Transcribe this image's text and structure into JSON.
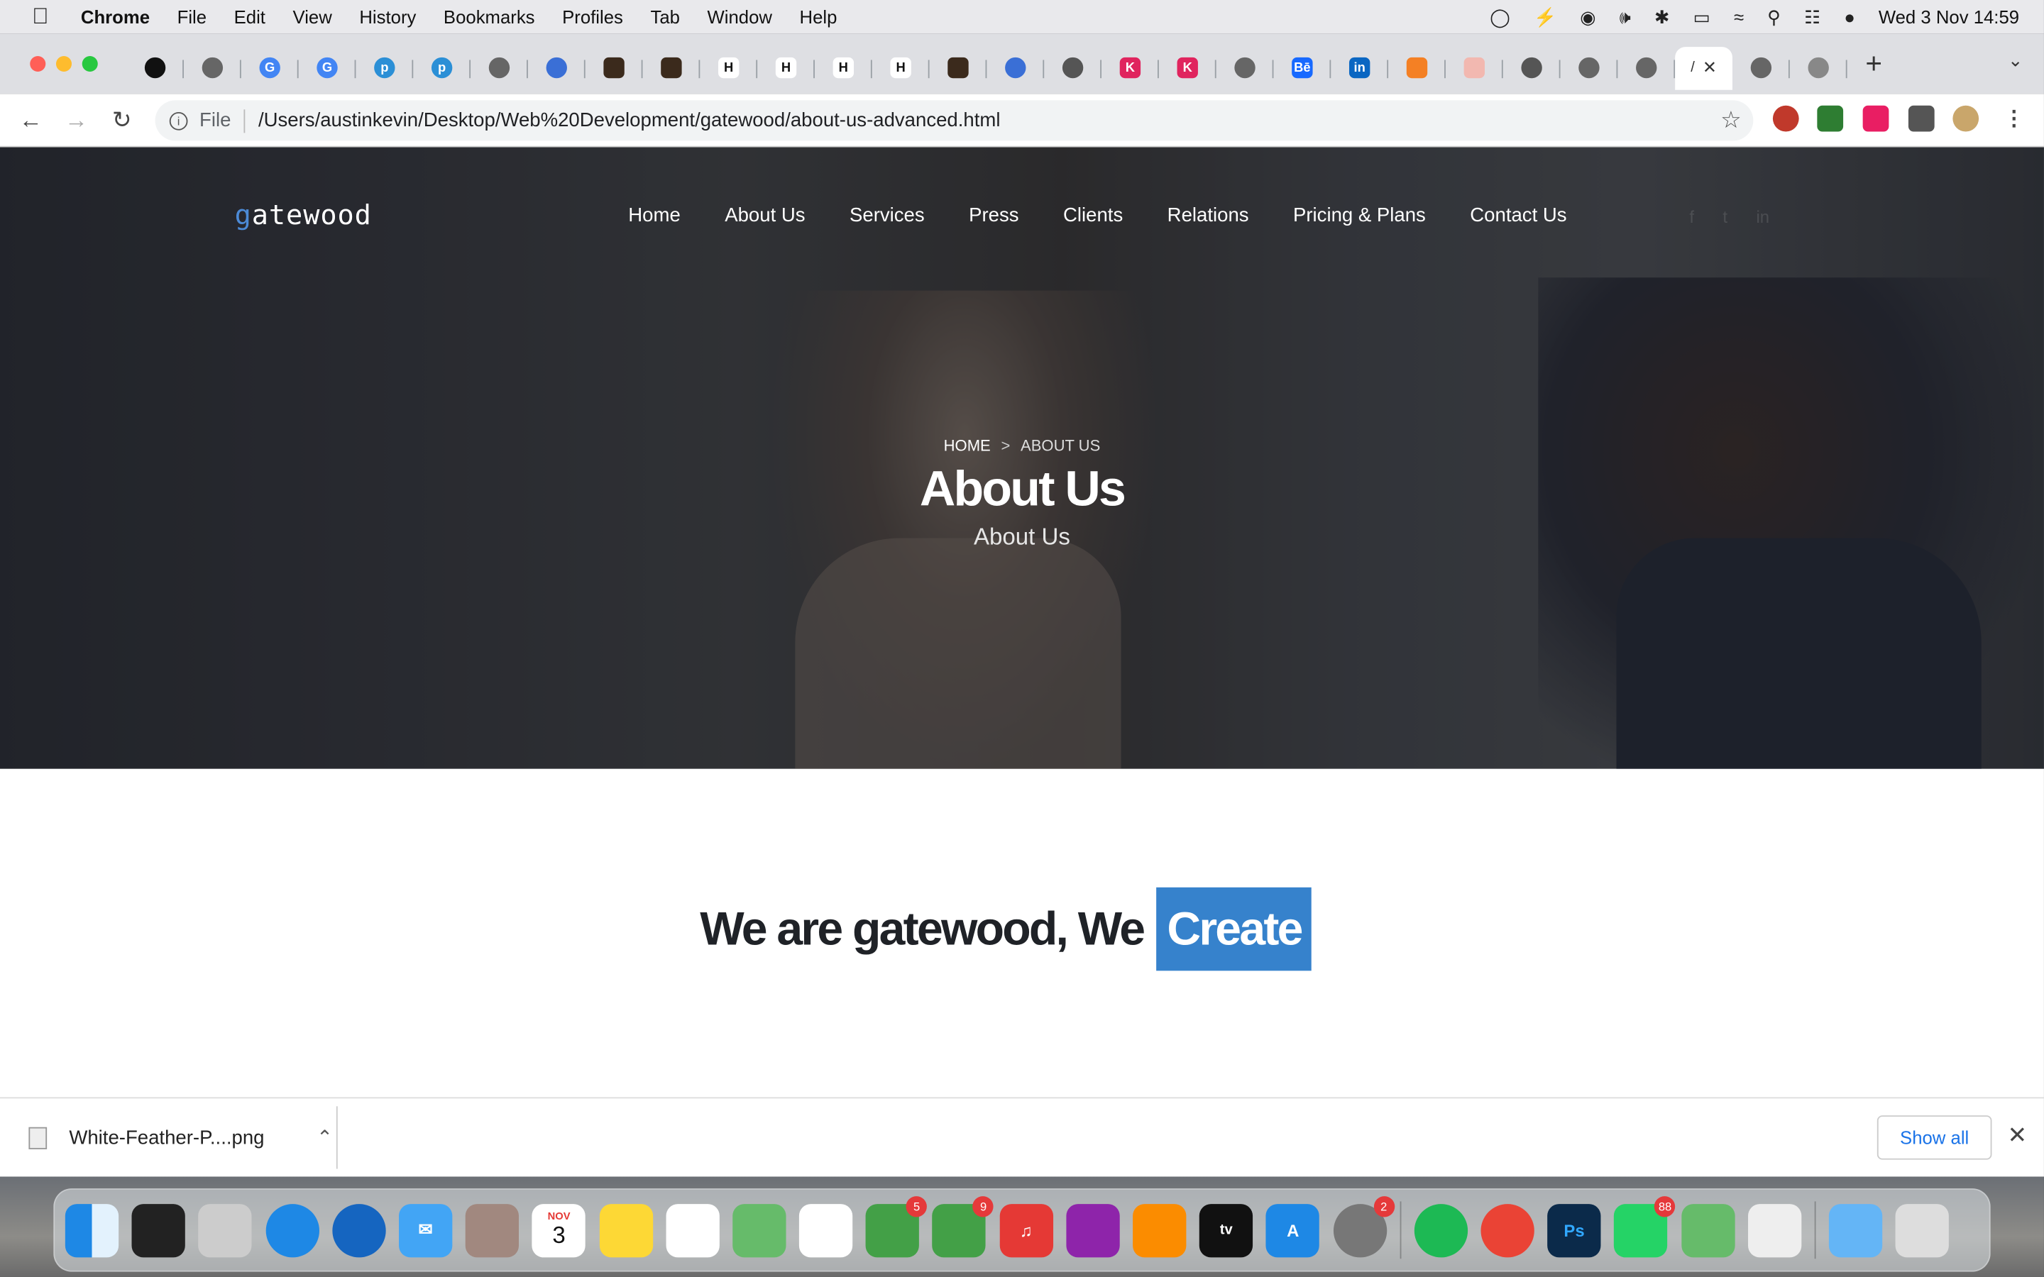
{
  "menubar": {
    "app": "Chrome",
    "items": [
      "File",
      "Edit",
      "View",
      "History",
      "Bookmarks",
      "Profiles",
      "Tab",
      "Window",
      "Help"
    ],
    "clock": "Wed 3 Nov  14:59"
  },
  "browser": {
    "url_scheme": "File",
    "url": "/Users/austinkevin/Desktop/Web%20Development/gatewood/about-us-advanced.html"
  },
  "site": {
    "logo_first": "g",
    "logo_rest": "atewood",
    "nav": [
      "Home",
      "About Us",
      "Services",
      "Press",
      "Clients",
      "Relations",
      "Pricing & Plans",
      "Contact Us"
    ],
    "breadcrumb": {
      "home": "HOME",
      "sep": ">",
      "current": "ABOUT US"
    },
    "hero_title": "About Us",
    "hero_subtitle": "About Us",
    "headline": "We are gatewood, We",
    "headline_highlight": "Create"
  },
  "downloads": {
    "file": "White-Feather-P....png",
    "show_all": "Show all"
  },
  "dock": {
    "calendar_month": "NOV",
    "calendar_day": "3",
    "messages_badge": "5",
    "facetime_badge": "9",
    "settings_badge": "2",
    "whatsapp_badge": "88"
  },
  "colors": {
    "accent": "#3682cc",
    "logo_accent": "#4c8ad6"
  }
}
